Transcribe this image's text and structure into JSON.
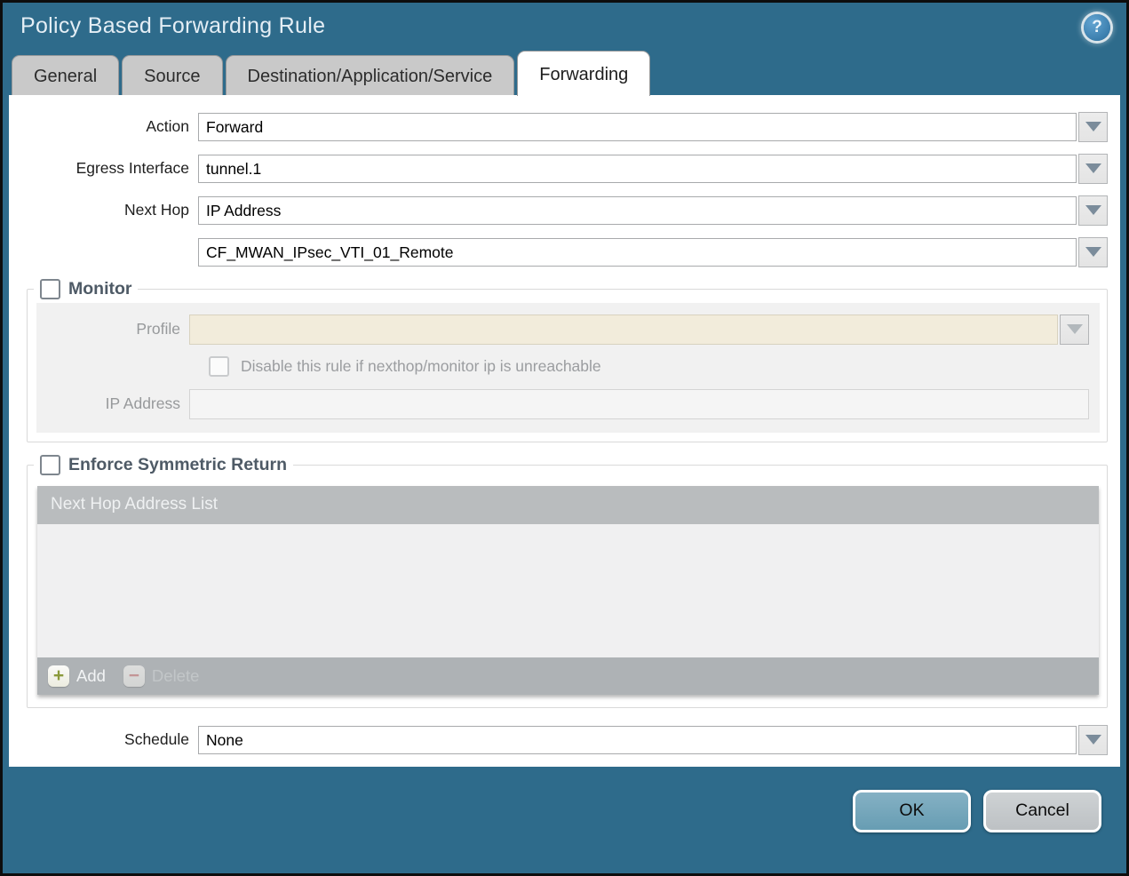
{
  "dialog": {
    "title": "Policy Based Forwarding Rule"
  },
  "icons": {
    "help": "?",
    "add_plus": "+",
    "delete_minus": "−"
  },
  "tabs": [
    {
      "label": "General",
      "active": false
    },
    {
      "label": "Source",
      "active": false
    },
    {
      "label": "Destination/Application/Service",
      "active": false
    },
    {
      "label": "Forwarding",
      "active": true
    }
  ],
  "form": {
    "action": {
      "label": "Action",
      "value": "Forward"
    },
    "egress_interface": {
      "label": "Egress Interface",
      "value": "tunnel.1"
    },
    "next_hop": {
      "label": "Next Hop",
      "value": "IP Address"
    },
    "next_hop_address": {
      "value": "CF_MWAN_IPsec_VTI_01_Remote"
    },
    "schedule": {
      "label": "Schedule",
      "value": "None"
    }
  },
  "monitor": {
    "label": "Monitor",
    "checked": false,
    "profile": {
      "label": "Profile",
      "value": ""
    },
    "disable_rule": {
      "label": "Disable this rule if nexthop/monitor ip is unreachable",
      "checked": false
    },
    "ip_address": {
      "label": "IP Address",
      "value": ""
    }
  },
  "enforce_symmetric_return": {
    "label": "Enforce Symmetric Return",
    "checked": false,
    "table": {
      "header": "Next Hop Address List",
      "rows": []
    },
    "add_label": "Add",
    "delete_label": "Delete",
    "delete_enabled": false
  },
  "footer": {
    "ok_label": "OK",
    "cancel_label": "Cancel"
  },
  "colors": {
    "teal_chrome": "#2e6b8b",
    "inactive_tab": "#c9c9c9",
    "disabled_profile_field": "#f2ecdb",
    "table_header": "#b9bcbe",
    "ok_button": "#74a6ba",
    "cancel_button": "#c5c9cc",
    "add_plus": "#8b9a3b",
    "delete_minus": "#c98f8f"
  }
}
